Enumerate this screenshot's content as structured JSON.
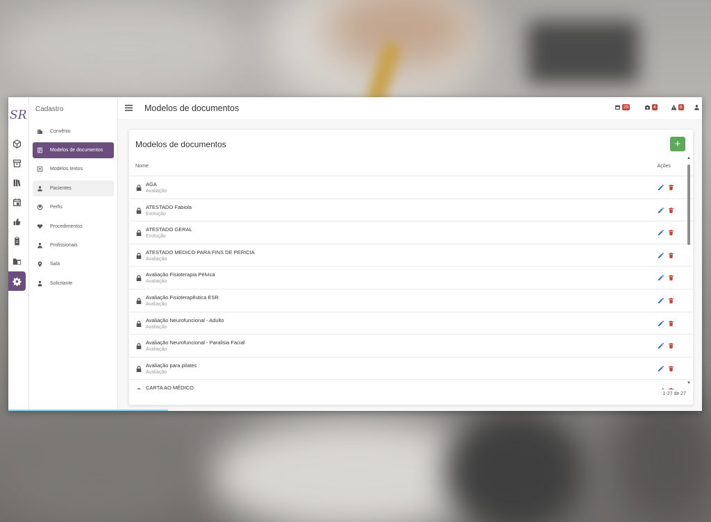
{
  "header": {
    "title": "Modelos de documentos",
    "badges": [
      {
        "icon": "calendar-icon",
        "count": "29"
      },
      {
        "icon": "medkit-icon",
        "count": "4"
      },
      {
        "icon": "warning-icon",
        "count": "8"
      }
    ]
  },
  "rail": {
    "logo": "SR",
    "items": [
      "cube-icon",
      "archive-icon",
      "books-icon",
      "calendar-icon",
      "thumbs-icon",
      "clipboard-icon",
      "folder-icon",
      "gear-icon"
    ]
  },
  "menu": {
    "title": "Cadastro",
    "items": [
      {
        "label": "Convênio",
        "icon": "building-icon"
      },
      {
        "label": "Modelos de documentos",
        "icon": "document-icon"
      },
      {
        "label": "Modelos textos",
        "icon": "text-doc-icon"
      },
      {
        "label": "Pacientes",
        "icon": "person-icon"
      },
      {
        "label": "Perfis",
        "icon": "profile-icon"
      },
      {
        "label": "Procedimentos",
        "icon": "heart-hand-icon"
      },
      {
        "label": "Profissionais",
        "icon": "professional-icon"
      },
      {
        "label": "Sala",
        "icon": "pin-icon"
      },
      {
        "label": "Solicitante",
        "icon": "requester-icon"
      }
    ]
  },
  "card": {
    "title": "Modelos de documentos",
    "add_label": "+",
    "columns": {
      "name": "Nome",
      "actions": "Ações"
    },
    "rows": [
      {
        "name": "AGA",
        "type": "Avaliação"
      },
      {
        "name": "ATESTADO Fabiola",
        "type": "Evolução"
      },
      {
        "name": "ATESTADO GERAL",
        "type": "Evolução"
      },
      {
        "name": "ATESTADO MEDICO PARA FINS DE PERICIA",
        "type": "Avaliação"
      },
      {
        "name": "Avaliação Fisioterapia Pélvica",
        "type": "Avaliação"
      },
      {
        "name": "Avaliação Fisioterapêutica ESR",
        "type": "Avaliação"
      },
      {
        "name": "Avaliação Neurofuncional - Adulto",
        "type": "Avaliação"
      },
      {
        "name": "Avaliação Neurofuncional - Paralisia Facial",
        "type": "Avaliação"
      },
      {
        "name": "Avaliação para pilates",
        "type": "Avaliação"
      },
      {
        "name": "CARTA AO MÉDICO",
        "type": ""
      }
    ],
    "pagination": "1-27 de 27"
  },
  "colors": {
    "primary": "#6b4e7d",
    "add": "#5ca95a",
    "badge": "#c9463d",
    "edit": "#3a6fc0",
    "delete": "#c9463d"
  }
}
